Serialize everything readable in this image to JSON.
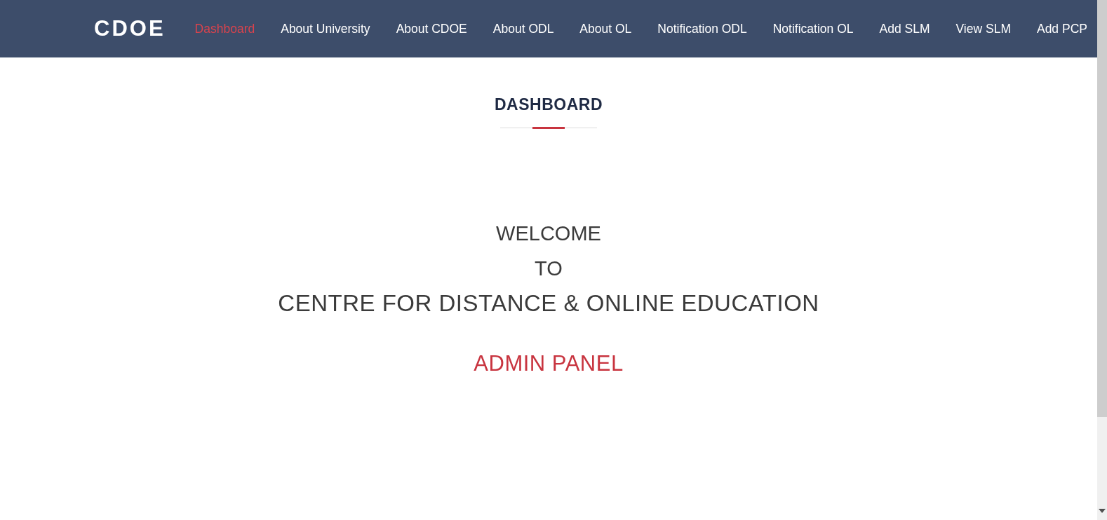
{
  "brand": "CDOE",
  "nav": [
    {
      "label": "Dashboard",
      "selected": true
    },
    {
      "label": "About University",
      "selected": false
    },
    {
      "label": "About CDOE",
      "selected": false
    },
    {
      "label": "About ODL",
      "selected": false
    },
    {
      "label": "About OL",
      "selected": false
    },
    {
      "label": "Notification ODL",
      "selected": false
    },
    {
      "label": "Notification OL",
      "selected": false
    },
    {
      "label": "Add SLM",
      "selected": false
    },
    {
      "label": "View SLM",
      "selected": false
    },
    {
      "label": "Add PCP",
      "selected": false
    }
  ],
  "section_title": "DASHBOARD",
  "welcome_lines": [
    "WELCOME",
    "TO",
    "CENTRE FOR DISTANCE & ONLINE EDUCATION"
  ],
  "subtitle": "ADMIN PANEL"
}
